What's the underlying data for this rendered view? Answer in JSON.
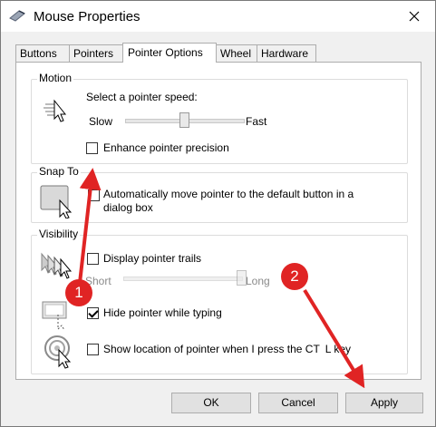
{
  "window": {
    "title": "Mouse Properties"
  },
  "tabs": [
    "Buttons",
    "Pointers",
    "Pointer Options",
    "Wheel",
    "Hardware"
  ],
  "motion": {
    "legend": "Motion",
    "speed_label": "Select a pointer speed:",
    "slow": "Slow",
    "fast": "Fast",
    "speed_level": 0.5,
    "enhance_label": "Enhance pointer precision",
    "enhance_checked": false
  },
  "snap_to": {
    "legend": "Snap To",
    "label": "Automatically move pointer to the default button in a dialog box",
    "label_line1": "Automatically move pointer to the default button in a",
    "label_line2": "dialog box",
    "checked": false
  },
  "visibility": {
    "legend": "Visibility",
    "trails_label": "Display pointer trails",
    "trails_checked": false,
    "short": "Short",
    "long": "Long",
    "trails_level": 1.0,
    "hide_label": "Hide pointer while typing",
    "hide_checked": true,
    "show_location_label": "Show location of pointer when I press the CTRL key",
    "show_location_visible_prefix": "Show location of pointer when I press the CT",
    "show_location_visible_suffix": "L key",
    "show_location_checked": false
  },
  "buttons": {
    "ok": "OK",
    "cancel": "Cancel",
    "apply": "Apply"
  },
  "annotations": {
    "badge1": "1",
    "badge2": "2",
    "color": "#e02424"
  }
}
